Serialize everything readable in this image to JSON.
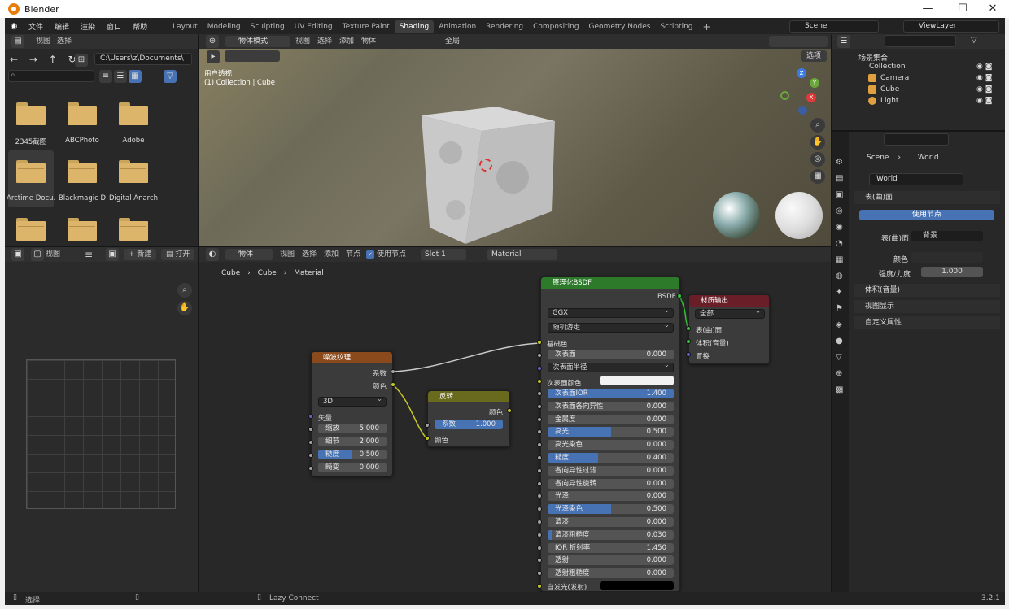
{
  "window": {
    "app_name": "Blender",
    "minimize": "—",
    "maximize": "☐",
    "close": "✕"
  },
  "menu": [
    "文件",
    "编辑",
    "渲染",
    "窗口",
    "帮助"
  ],
  "workspaces": [
    "Layout",
    "Modeling",
    "Sculpting",
    "UV Editing",
    "Texture Paint",
    "Shading",
    "Animation",
    "Rendering",
    "Compositing",
    "Geometry Nodes",
    "Scripting"
  ],
  "active_workspace": "Shading",
  "scene_field": "Scene",
  "view_layer_field": "ViewLayer",
  "file_browser": {
    "menus": [
      "视图",
      "选择"
    ],
    "path": "C:\\Users\\z\\Documents\\",
    "folders": [
      "2345截图",
      "ABCPhoto",
      "Adobe",
      "Arctime Docu...",
      "Blackmagic D",
      "Digital Anarch",
      "",
      "",
      ""
    ]
  },
  "image_editor": {
    "view_menu": "视图",
    "new_btn": "新建",
    "open_btn": "打开"
  },
  "viewport": {
    "mode": "物体模式",
    "menus": [
      "视图",
      "选择",
      "添加",
      "物体"
    ],
    "transform": "全局",
    "options": "选项",
    "info_line1": "用户透视",
    "info_line2": "(1) Collection | Cube"
  },
  "node_editor": {
    "object_menu": "物体",
    "menus": [
      "视图",
      "选择",
      "添加",
      "节点"
    ],
    "use_nodes": "使用节点",
    "slot": "Slot 1",
    "material": "Material",
    "breadcrumb": [
      "Cube",
      "Cube",
      "Material"
    ]
  },
  "noise_node": {
    "title": "噪波纹理",
    "out_fac": "系数",
    "out_color": "颜色",
    "dim": "3D",
    "vector": "矢量",
    "inputs": [
      {
        "label": "缩放",
        "value": "5.000"
      },
      {
        "label": "细节",
        "value": "2.000"
      },
      {
        "label": "糙度",
        "value": "0.500",
        "fill": 0.5
      },
      {
        "label": "畸变",
        "value": "0.000"
      }
    ]
  },
  "invert_node": {
    "title": "反转",
    "out_color": "颜色",
    "fac_label": "系数",
    "fac_value": "1.000",
    "in_color": "颜色"
  },
  "bsdf_node": {
    "title": "原理化BSDF",
    "out": "BSDF",
    "dist": "GGX",
    "sss_method": "随机游走",
    "base_color": "基础色",
    "sss": {
      "label": "次表面",
      "value": "0.000"
    },
    "sss_radius": "次表面半径",
    "sss_color": "次表面颜色",
    "inputs": [
      {
        "label": "次表面IOR",
        "value": "1.400",
        "fill": 1.0
      },
      {
        "label": "次表面各向异性",
        "value": "0.000"
      },
      {
        "label": "金属度",
        "value": "0.000"
      },
      {
        "label": "高光",
        "value": "0.500",
        "fill": 0.5
      },
      {
        "label": "高光染色",
        "value": "0.000"
      },
      {
        "label": "糙度",
        "value": "0.400",
        "fill": 0.4
      },
      {
        "label": "各向异性过滤",
        "value": "0.000"
      },
      {
        "label": "各向异性旋转",
        "value": "0.000"
      },
      {
        "label": "光泽",
        "value": "0.000"
      },
      {
        "label": "光泽染色",
        "value": "0.500",
        "fill": 0.5
      },
      {
        "label": "清漆",
        "value": "0.000"
      },
      {
        "label": "清漆粗糙度",
        "value": "0.030",
        "fill": 0.03
      },
      {
        "label": "IOR 折射率",
        "value": "1.450"
      },
      {
        "label": "透射",
        "value": "0.000"
      },
      {
        "label": "透射粗糙度",
        "value": "0.000"
      }
    ],
    "emission": "自发光(发射)"
  },
  "output_node": {
    "title": "材质输出",
    "target": "全部",
    "surface": "表(曲)面",
    "volume": "体积(音量)",
    "displacement": "置换"
  },
  "outliner": {
    "root": "场景集合",
    "collection": "Collection",
    "objects": [
      "Camera",
      "Cube",
      "Light"
    ]
  },
  "properties": {
    "breadcrumb_scene": "Scene",
    "breadcrumb_world": "World",
    "world_field": "World",
    "surface_panel": "表(曲)面",
    "use_nodes_btn": "使用节点",
    "surface_label": "表(曲)面",
    "surface_value": "背景",
    "color_label": "颜色",
    "strength_label": "强度/力度",
    "strength_value": "1.000",
    "panels": [
      "体积(音量)",
      "视图显示",
      "自定义属性"
    ]
  },
  "statusbar": {
    "select": "选择",
    "lazy": "Lazy Connect",
    "version": "3.2.1"
  },
  "colors": {
    "accent": "#4772b3",
    "noise_header": "#8b4a1c",
    "bsdf_header": "#2d7a2a",
    "output_header": "#6a1e27",
    "invert_header": "#6a6a1e"
  }
}
